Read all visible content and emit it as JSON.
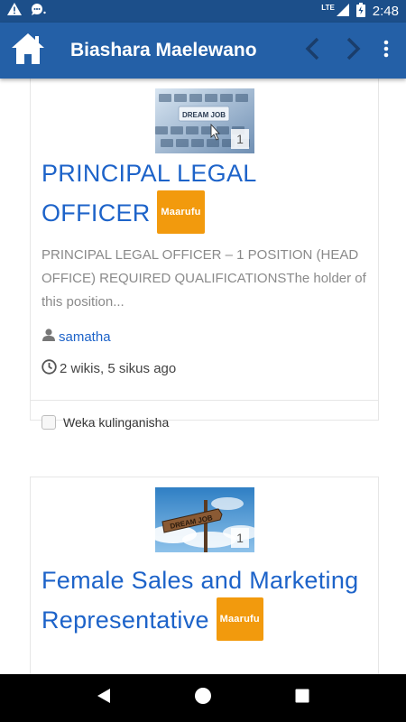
{
  "status_bar": {
    "time": "2:48",
    "network": "LTE",
    "icons": [
      "warning-icon",
      "chat-icon",
      "signal-icon",
      "battery-icon"
    ]
  },
  "app_bar": {
    "title": "Biashara Maelewano",
    "icons": [
      "home-icon",
      "back-arrow-icon",
      "forward-arrow-icon",
      "more-vert-icon"
    ]
  },
  "listings": [
    {
      "title": "PRINCIPAL LEGAL OFFICER",
      "badge": "Maarufu",
      "image_text": "DREAM JOB",
      "image_count": "1",
      "excerpt": "PRINCIPAL LEGAL OFFICER – 1 POSITION (HEAD OFFICE) REQUIRED QUALIFICATIONSThe holder of this position...",
      "author": "samatha",
      "time_ago": "2 wikis, 5 sikus ago",
      "compare_label": "Weka kulinganisha"
    },
    {
      "title": "Female Sales and Marketing Representative",
      "badge": "Maarufu",
      "image_text": "DREAM JOB",
      "image_count": "1"
    }
  ],
  "colors": {
    "app_bar": "#2460a7",
    "status_bar": "#1c4f8a",
    "link": "#1d63c9",
    "badge": "#f29a0d"
  }
}
